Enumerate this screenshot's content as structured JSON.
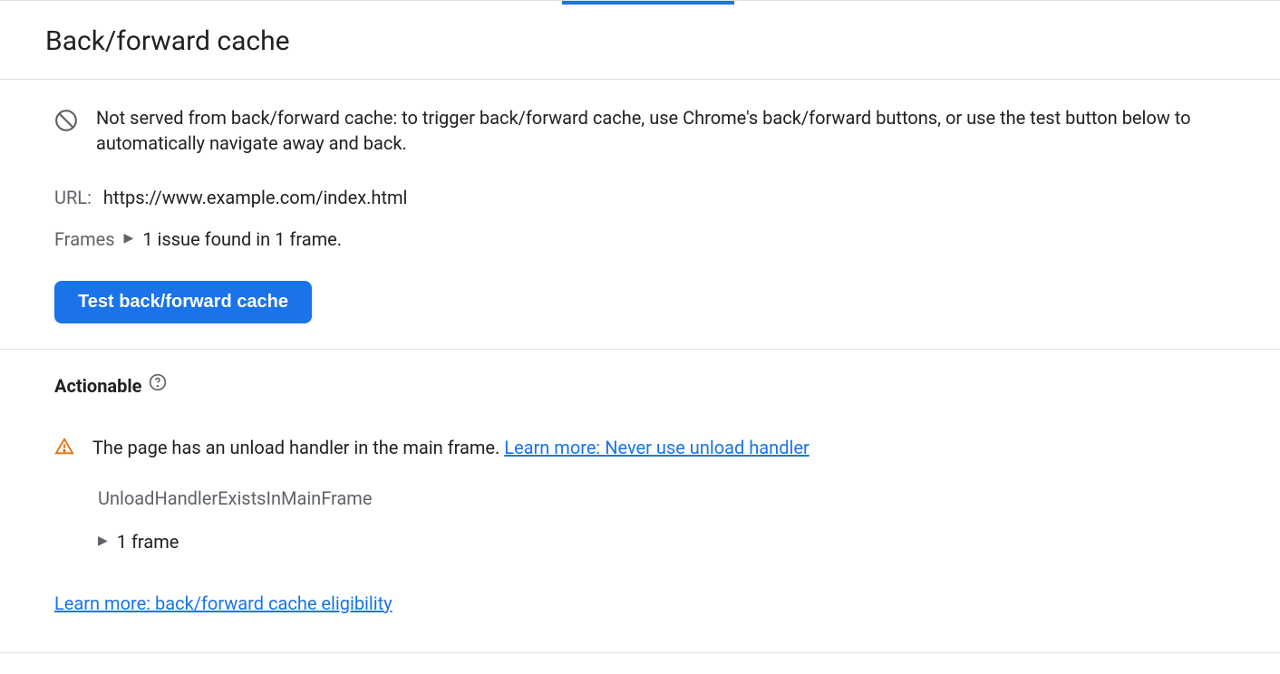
{
  "header": {
    "title": "Back/forward cache"
  },
  "notice": {
    "text": "Not served from back/forward cache: to trigger back/forward cache, use Chrome's back/forward buttons, or use the test button below to automatically navigate away and back."
  },
  "url": {
    "label": "URL:",
    "value": "https://www.example.com/index.html"
  },
  "frames": {
    "label": "Frames",
    "summary": "1 issue found in 1 frame."
  },
  "button": {
    "test_label": "Test back/forward cache"
  },
  "actionable": {
    "title": "Actionable",
    "issue_text": "The page has an unload handler in the main frame. ",
    "issue_link": "Learn more: Never use unload handler",
    "issue_code": "UnloadHandlerExistsInMainFrame",
    "frame_count": "1 frame"
  },
  "footer": {
    "eligibility_link": "Learn more: back/forward cache eligibility"
  }
}
